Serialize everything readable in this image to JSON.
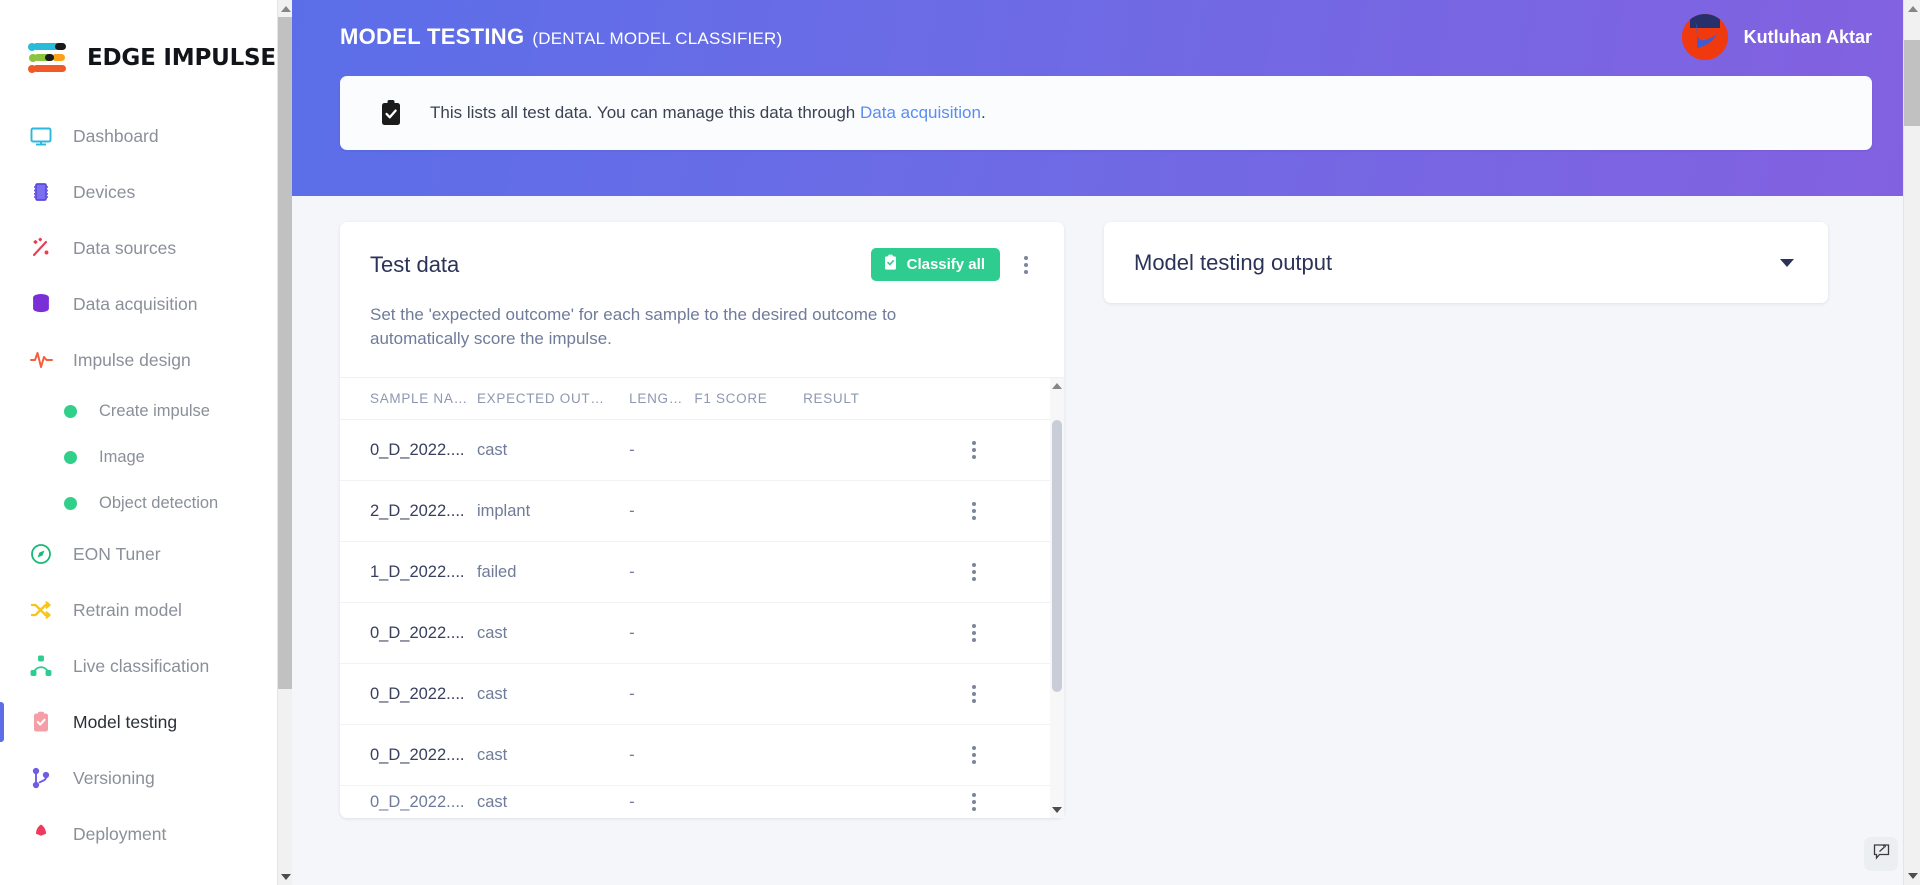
{
  "brand": {
    "name": "EDGE IMPULSE"
  },
  "sidebar": {
    "items": [
      {
        "label": "Dashboard",
        "icon": "monitor-icon",
        "active": false,
        "sub": false
      },
      {
        "label": "Devices",
        "icon": "chip-icon",
        "active": false,
        "sub": false
      },
      {
        "label": "Data sources",
        "icon": "magic-wand-icon",
        "active": false,
        "sub": false
      },
      {
        "label": "Data acquisition",
        "icon": "database-icon",
        "active": false,
        "sub": false
      },
      {
        "label": "Impulse design",
        "icon": "pulse-icon",
        "active": false,
        "sub": false
      },
      {
        "label": "Create impulse",
        "icon": "green-dot-icon",
        "active": false,
        "sub": true
      },
      {
        "label": "Image",
        "icon": "green-dot-icon",
        "active": false,
        "sub": true
      },
      {
        "label": "Object detection",
        "icon": "green-dot-icon",
        "active": false,
        "sub": true
      },
      {
        "label": "EON Tuner",
        "icon": "compass-icon",
        "active": false,
        "sub": false
      },
      {
        "label": "Retrain model",
        "icon": "shuffle-icon",
        "active": false,
        "sub": false
      },
      {
        "label": "Live classification",
        "icon": "network-icon",
        "active": false,
        "sub": false
      },
      {
        "label": "Model testing",
        "icon": "clipboard-check-icon",
        "active": true,
        "sub": false
      },
      {
        "label": "Versioning",
        "icon": "git-branch-icon",
        "active": false,
        "sub": false
      },
      {
        "label": "Deployment",
        "icon": "rocket-icon",
        "active": false,
        "sub": false
      }
    ]
  },
  "header": {
    "title": "MODEL TESTING",
    "project": "(DENTAL MODEL CLASSIFIER)",
    "user_name": "Kutluhan Aktar",
    "gradient_start": "#5b6ee8",
    "gradient_end": "#8361e0"
  },
  "banner": {
    "icon": "clipboard-check-icon",
    "text_before": "This lists all test data. You can manage this data through ",
    "link_text": "Data acquisition",
    "text_after": "."
  },
  "test_data": {
    "title": "Test data",
    "classify_button": "Classify all",
    "classify_icon": "clipboard-check-icon",
    "menu_icon": "kebab-menu-icon",
    "description": "Set the 'expected outcome' for each sample to the desired outcome to automatically score the impulse.",
    "columns": [
      "SAMPLE NA…",
      "EXPECTED OUT…",
      "LENG…",
      "F1 SCORE",
      "RESULT"
    ],
    "rows": [
      {
        "sample_name": "0_D_2022....",
        "expected_outcome": "cast",
        "length": "-",
        "f1_score": "",
        "result": ""
      },
      {
        "sample_name": "2_D_2022....",
        "expected_outcome": "implant",
        "length": "-",
        "f1_score": "",
        "result": ""
      },
      {
        "sample_name": "1_D_2022....",
        "expected_outcome": "failed",
        "length": "-",
        "f1_score": "",
        "result": ""
      },
      {
        "sample_name": "0_D_2022....",
        "expected_outcome": "cast",
        "length": "-",
        "f1_score": "",
        "result": ""
      },
      {
        "sample_name": "0_D_2022....",
        "expected_outcome": "cast",
        "length": "-",
        "f1_score": "",
        "result": ""
      },
      {
        "sample_name": "0_D_2022....",
        "expected_outcome": "cast",
        "length": "-",
        "f1_score": "",
        "result": ""
      }
    ],
    "partial_row": {
      "sample_name": "0_D_2022....",
      "expected_outcome": "cast",
      "length": "-"
    }
  },
  "model_testing_output": {
    "title": "Model testing output",
    "caret_icon": "chevron-down-icon"
  },
  "feedback_widget": {
    "icon": "feedback-pencil-icon"
  },
  "colors": {
    "accent_green": "#2ecc8f",
    "accent_blue": "#5b8df0",
    "page_bg": "#f4f6fa",
    "title_navy": "#2b3357"
  }
}
